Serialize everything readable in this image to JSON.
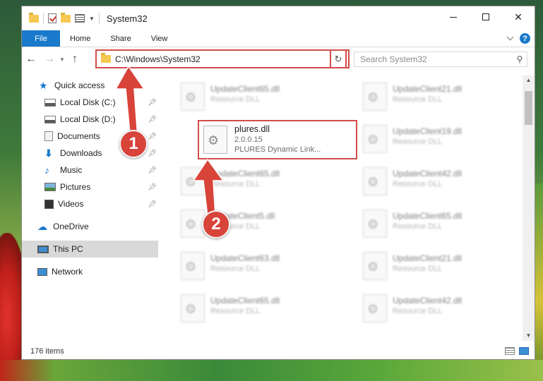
{
  "window": {
    "title": "System32",
    "ribbon_tabs": [
      "File",
      "Home",
      "Share",
      "View"
    ],
    "help_glyph": "?"
  },
  "navbar": {
    "address": "C:\\Windows\\System32",
    "search_placeholder": "Search System32"
  },
  "sidebar": {
    "items": [
      {
        "label": "Quick access",
        "icon": "quick-access-star-icon"
      },
      {
        "label": "Local Disk (C:)",
        "icon": "drive-icon",
        "pinned": true
      },
      {
        "label": "Local Disk (D:)",
        "icon": "drive-icon",
        "pinned": true
      },
      {
        "label": "Documents",
        "icon": "documents-icon",
        "pinned": true
      },
      {
        "label": "Downloads",
        "icon": "downloads-icon",
        "pinned": true
      },
      {
        "label": "Music",
        "icon": "music-icon",
        "pinned": true
      },
      {
        "label": "Pictures",
        "icon": "pictures-icon",
        "pinned": true
      },
      {
        "label": "Videos",
        "icon": "videos-icon",
        "pinned": true
      },
      {
        "label": "OneDrive",
        "icon": "onedrive-icon"
      },
      {
        "label": "This PC",
        "icon": "this-pc-icon",
        "selected": true
      },
      {
        "label": "Network",
        "icon": "network-icon"
      }
    ]
  },
  "files": {
    "left_column": [
      {
        "name": "UpdateClient65.dll",
        "type": "Resource DLL"
      },
      {
        "name": "UpdateClient65.dll",
        "type": "Resource DLL"
      },
      {
        "name": "UpdateClient5.dll",
        "type": "Resource DLL"
      },
      {
        "name": "UpdateClient63.dll",
        "type": "Resource DLL"
      },
      {
        "name": "UpdateClient65.dll",
        "type": "Resource DLL"
      }
    ],
    "right_column": [
      {
        "name": "UpdateClient21.dll",
        "type": "Resource DLL"
      },
      {
        "name": "UpdateClient19.dll",
        "type": "Resource DLL"
      },
      {
        "name": "UpdateClient42.dll",
        "type": "Resource DLL"
      },
      {
        "name": "UpdateClient65.dll",
        "type": "Resource DLL"
      },
      {
        "name": "UpdateClient21.dll",
        "type": "Resource DLL"
      },
      {
        "name": "UpdateClient42.dll",
        "type": "Resource DLL"
      }
    ],
    "highlighted": {
      "name": "plures.dll",
      "version": "2.0.0.15",
      "description": "PLURES Dynamic Link..."
    }
  },
  "status": {
    "item_count": "176 items"
  },
  "annotations": {
    "badge1": "1",
    "badge2": "2",
    "color": "#d8433a"
  }
}
